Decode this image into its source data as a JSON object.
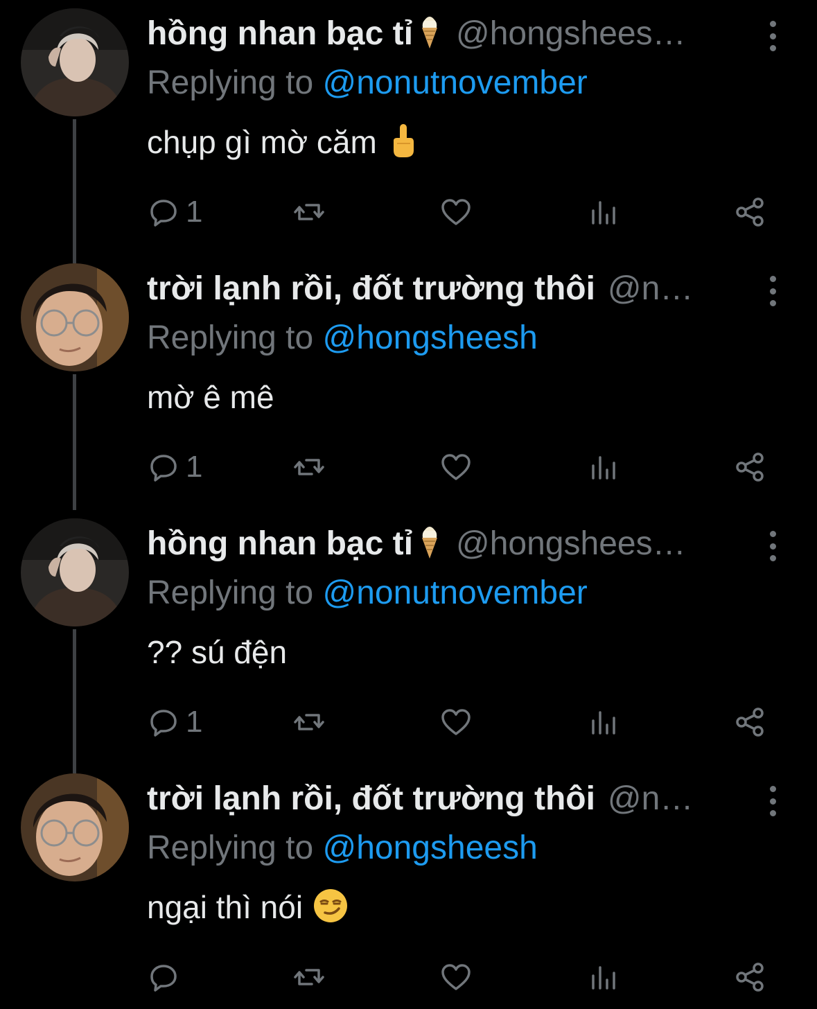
{
  "colors": {
    "background": "#000000",
    "text": "#e7e9ea",
    "muted": "#71767b",
    "mention": "#1d9bf0",
    "thread_line": "#3e4144"
  },
  "tweets": [
    {
      "display_name": "hồng nhan bạc tỉ",
      "name_emoji": "ice-cream-cone-icon",
      "handle": "@hongshees…",
      "replying_prefix": "Replying to",
      "replying_to": "@nonutnovember",
      "text": "chụp gì mờ căm",
      "text_emoji": "middle-finger-icon",
      "reply_count": "1",
      "avatar": "avatar-hong"
    },
    {
      "display_name": "trời lạnh rồi, đốt trường thôi",
      "name_emoji": "",
      "handle": "@n…",
      "replying_prefix": "Replying to",
      "replying_to": "@hongsheesh",
      "text": "mờ ê mê",
      "text_emoji": "",
      "reply_count": "1",
      "avatar": "avatar-glasses"
    },
    {
      "display_name": "hồng nhan bạc tỉ",
      "name_emoji": "ice-cream-cone-icon",
      "handle": "@hongshees…",
      "replying_prefix": "Replying to",
      "replying_to": "@nonutnovember",
      "text": "?? sú đện",
      "text_emoji": "",
      "reply_count": "1",
      "avatar": "avatar-hong"
    },
    {
      "display_name": "trời lạnh rồi, đốt trường thôi",
      "name_emoji": "",
      "handle": "@n…",
      "replying_prefix": "Replying to",
      "replying_to": "@hongsheesh",
      "text": "ngại thì nói",
      "text_emoji": "smirking-face-icon",
      "reply_count": "",
      "avatar": "avatar-glasses"
    }
  ]
}
